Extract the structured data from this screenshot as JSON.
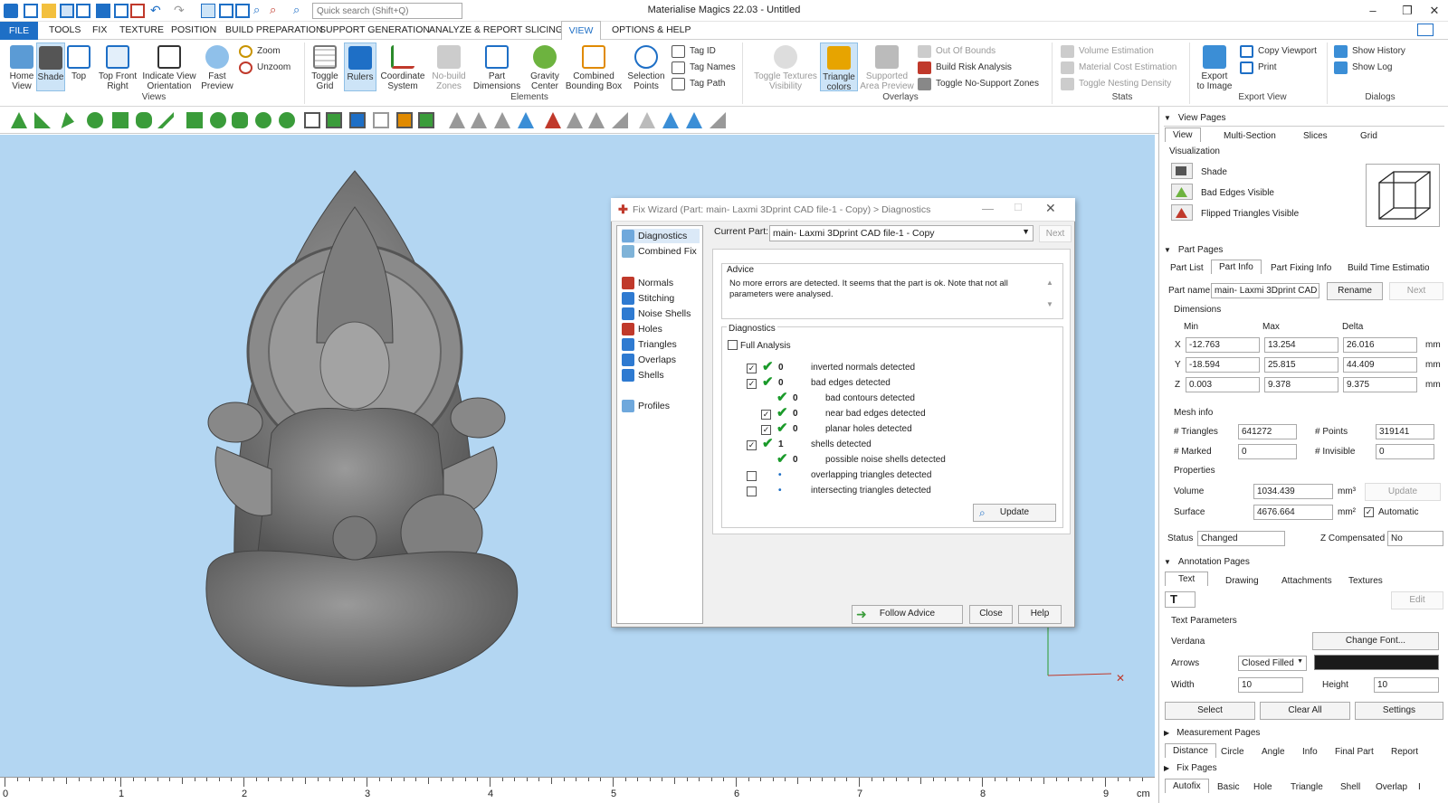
{
  "window": {
    "title": "Materialise Magics 22.03 - Untitled",
    "search_placeholder": "Quick search (Shift+Q)"
  },
  "menu": {
    "file": "FILE",
    "tabs": [
      "TOOLS",
      "FIX",
      "TEXTURE",
      "POSITION",
      "BUILD PREPARATION",
      "SUPPORT GENERATION",
      "ANALYZE & REPORT",
      "SLICING"
    ],
    "active": "VIEW",
    "tabs_after": [
      "OPTIONS & HELP"
    ]
  },
  "ribbon": {
    "views": {
      "home": "Home\nView",
      "shade": "Shade",
      "top": "Top",
      "top_front_right": "Top Front\nRight",
      "indicate": "Indicate View\nOrientation",
      "fast": "Fast\nPreview",
      "zoom": "Zoom",
      "unzoom": "Unzoom",
      "group": "Views"
    },
    "elements": {
      "toggle_grid": "Toggle\nGrid",
      "rulers": "Rulers",
      "coord": "Coordinate\nSystem",
      "nobuild": "No-build\nZones",
      "partdim": "Part\nDimensions",
      "gravity": "Gravity\nCenter",
      "bbox": "Combined\nBounding Box",
      "selpts": "Selection\nPoints",
      "tag_id": "Tag ID",
      "tag_names": "Tag Names",
      "tag_path": "Tag Path",
      "group": "Elements"
    },
    "overlays": {
      "toggle_textures": "Toggle Textures\nVisibility",
      "triangle_colors": "Triangle\ncolors",
      "supported": "Supported\nArea Preview",
      "out_of_bounds": "Out Of Bounds",
      "build_risk": "Build Risk Analysis",
      "toggle_nosupport": "Toggle No-Support Zones",
      "group": "Overlays"
    },
    "stats": {
      "volume": "Volume Estimation",
      "material": "Material Cost Estimation",
      "nesting": "Toggle Nesting Density",
      "group": "Stats"
    },
    "export": {
      "export_image": "Export\nto Image",
      "copy_viewport": "Copy Viewport",
      "print": "Print",
      "group": "Export View"
    },
    "dialogs": {
      "show_history": "Show History",
      "show_log": "Show Log",
      "group": "Dialogs"
    }
  },
  "ruler": {
    "labels": [
      "0",
      "1",
      "2",
      "3",
      "4",
      "5",
      "6",
      "7",
      "8",
      "9"
    ],
    "unit": "cm"
  },
  "dialog": {
    "title": "Fix Wizard (Part: main- Laxmi 3Dprint CAD file-1 - Copy) > Diagnostics",
    "nav": [
      {
        "label": "Diagnostics",
        "color": "#6fa8dc"
      },
      {
        "label": "Combined Fix",
        "color": "#7fb3d8"
      },
      {
        "label": "Normals",
        "color": "#c0392b"
      },
      {
        "label": "Stitching",
        "color": "#2e7ad1"
      },
      {
        "label": "Noise Shells",
        "color": "#2e7ad1"
      },
      {
        "label": "Holes",
        "color": "#c0392b"
      },
      {
        "label": "Triangles",
        "color": "#2e7ad1"
      },
      {
        "label": "Overlaps",
        "color": "#2e7ad1"
      },
      {
        "label": "Shells",
        "color": "#2e7ad1"
      },
      {
        "label": "Profiles",
        "color": "#6fa8dc"
      }
    ],
    "current_part_label": "Current Part:",
    "current_part": "main- Laxmi 3Dprint CAD file-1 - Copy",
    "next": "Next",
    "advice_title": "Advice",
    "advice_text": "No more errors are detected. It seems that the part is ok. Note that not all parameters were analysed.",
    "diag_title": "Diagnostics",
    "full_analysis": "Full Analysis",
    "rows": [
      {
        "checked": true,
        "ok": true,
        "count": "0",
        "label": "inverted normals detected",
        "indent": 0
      },
      {
        "checked": true,
        "ok": true,
        "count": "0",
        "label": "bad edges detected",
        "indent": 0
      },
      {
        "checked": false,
        "ok": true,
        "count": "0",
        "label": "bad contours detected",
        "indent": 1,
        "nochk": true
      },
      {
        "checked": true,
        "ok": true,
        "count": "0",
        "label": "near bad edges detected",
        "indent": 1
      },
      {
        "checked": true,
        "ok": true,
        "count": "0",
        "label": "planar holes detected",
        "indent": 1
      },
      {
        "checked": true,
        "ok": true,
        "count": "1",
        "label": "shells detected",
        "indent": 0
      },
      {
        "checked": false,
        "ok": true,
        "count": "0",
        "label": "possible noise shells detected",
        "indent": 1,
        "nochk": true
      },
      {
        "checked": false,
        "ok": false,
        "count": "•",
        "label": "overlapping triangles detected",
        "indent": 0
      },
      {
        "checked": false,
        "ok": false,
        "count": "•",
        "label": "intersecting triangles detected",
        "indent": 0
      }
    ],
    "update": "Update",
    "follow_advice": "Follow Advice",
    "close": "Close",
    "help": "Help"
  },
  "panel": {
    "view_pages": "View Pages",
    "view_tabs": [
      "View",
      "Multi-Section",
      "Slices",
      "Grid"
    ],
    "visualization": "Visualization",
    "vis_items": [
      "Shade",
      "Bad Edges Visible",
      "Flipped Triangles Visible"
    ],
    "part_pages": "Part Pages",
    "part_tabs": [
      "Part List",
      "Part Info",
      "Part Fixing Info",
      "Build Time Estimation"
    ],
    "part_name_label": "Part name",
    "part_name": "main- Laxmi 3Dprint CAD",
    "rename": "Rename",
    "next": "Next",
    "dimensions": "Dimensions",
    "dim_headers": [
      "Min",
      "Max",
      "Delta"
    ],
    "dims": [
      {
        "axis": "X",
        "min": "-12.763",
        "max": "13.254",
        "delta": "26.016",
        "unit": "mm"
      },
      {
        "axis": "Y",
        "min": "-18.594",
        "max": "25.815",
        "delta": "44.409",
        "unit": "mm"
      },
      {
        "axis": "Z",
        "min": "0.003",
        "max": "9.378",
        "delta": "9.375",
        "unit": "mm"
      }
    ],
    "mesh_info": "Mesh info",
    "triangles_label": "# Triangles",
    "triangles": "641272",
    "points_label": "# Points",
    "points": "319141",
    "marked_label": "# Marked",
    "marked": "0",
    "invisible_label": "# Invisible",
    "invisible": "0",
    "properties": "Properties",
    "volume_label": "Volume",
    "volume": "1034.439",
    "volume_unit": "mm³",
    "update": "Update",
    "surface_label": "Surface",
    "surface": "4676.664",
    "surface_unit": "mm²",
    "automatic": "Automatic",
    "status_label": "Status",
    "status": "Changed",
    "zcomp_label": "Z Compensated",
    "zcomp": "No",
    "annotation_pages": "Annotation Pages",
    "ann_tabs": [
      "Text",
      "Drawing",
      "Attachments",
      "Textures"
    ],
    "edit": "Edit",
    "text_params": "Text Parameters",
    "font": "Verdana",
    "change_font": "Change Font...",
    "arrows_label": "Arrows",
    "arrows": "Closed Filled",
    "width_label": "Width",
    "width": "10",
    "height_label": "Height",
    "height": "10",
    "select": "Select",
    "clear_all": "Clear All",
    "settings": "Settings",
    "measurement_pages": "Measurement Pages",
    "meas_tabs": [
      "Distance",
      "Circle",
      "Angle",
      "Info",
      "Final Part",
      "Report"
    ],
    "fix_pages": "Fix Pages",
    "fix_tabs": [
      "Autofix",
      "Basic",
      "Hole",
      "Triangle",
      "Shell",
      "Overlap",
      "I"
    ]
  },
  "colors": {
    "accent": "#1e6fc6",
    "viewport": "#b3d6f2",
    "ok_green": "#1a9a2a"
  }
}
